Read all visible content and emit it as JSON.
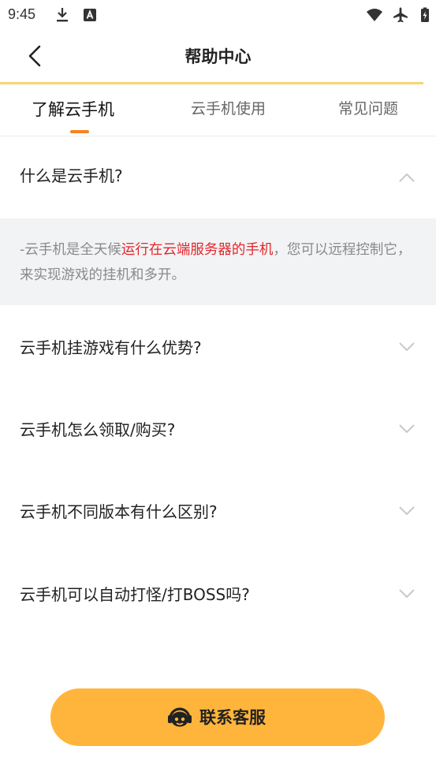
{
  "status_bar": {
    "time": "9:45",
    "icons": [
      "download-icon",
      "a-badge-icon",
      "wifi-icon",
      "airplane-icon",
      "battery-charging-icon"
    ]
  },
  "header": {
    "title": "帮助中心",
    "back_icon": "chevron-left-icon"
  },
  "tabs": [
    {
      "label": "了解云手机",
      "active": true
    },
    {
      "label": "云手机使用",
      "active": false
    },
    {
      "label": "常见问题",
      "active": false
    }
  ],
  "faq": [
    {
      "question": "什么是云手机?",
      "expanded": true
    },
    {
      "question": "云手机挂游戏有什么优势?",
      "expanded": false
    },
    {
      "question": "云手机怎么领取/购买?",
      "expanded": false
    },
    {
      "question": "云手机不同版本有什么区别?",
      "expanded": false
    },
    {
      "question": "云手机可以自动打怪/打BOSS吗?",
      "expanded": false
    }
  ],
  "answer": {
    "prefix": "-云手机是全天候",
    "highlight": "运行在云端服务器的手机",
    "suffix": "，您可以远程控制它，来实现游戏的挂机和多开。"
  },
  "contact_button": {
    "label": "联系客服",
    "icon": "headset-icon"
  },
  "colors": {
    "accent": "#FFB53C",
    "tab_indicator": "#F5841F",
    "highlight_red": "#E3262B",
    "answer_bg": "#F2F3F5"
  }
}
